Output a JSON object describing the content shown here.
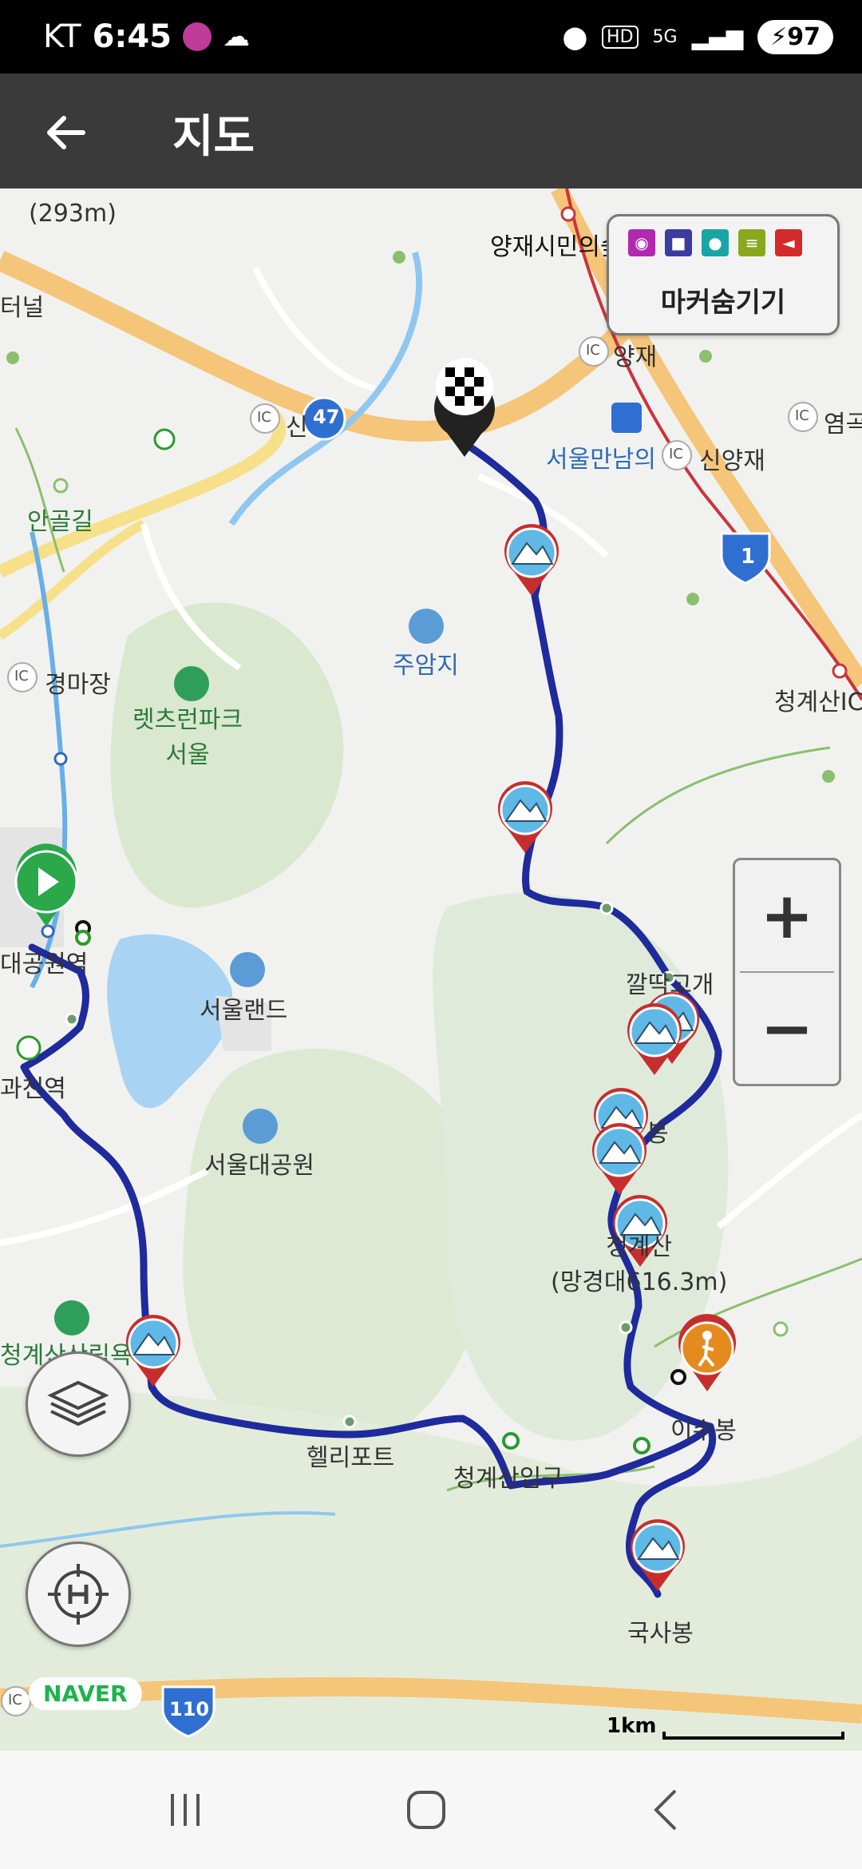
{
  "status_bar": {
    "carrier": "KT",
    "time": "6:45",
    "battery": "97"
  },
  "app_bar": {
    "title": "지도",
    "back_icon": "arrow-left-icon"
  },
  "map": {
    "place_labels": {
      "yangjae_forest": "양재시민의숲",
      "yangjae": "양재",
      "seoul_manam": "서울만남의",
      "sinyangjae": "신양재",
      "yeomgok": "염곡",
      "juamji": "주암지",
      "gyeongmajang": "경마장",
      "letsrun": "렛츠런파크\n서울",
      "seoulland": "서울랜드",
      "seoul_grand_park": "서울대공원",
      "daegongwon_station": "대공원역",
      "gwacheon_station": "과천역",
      "cheonggye_recreation": "청계산산림욕",
      "heliport": "헬리포트",
      "cheonggye_entrance": "청계산입구",
      "isubong": "이수봉",
      "guksabong": "국사봉",
      "kkalttak_pass": "깔딱고개",
      "peak_bong": "봉",
      "cheonggye_peak": "청계산\n(망경대616.3m)",
      "cheonggye_ic": "청계산IC",
      "angolgil": "안골길",
      "tunnel": "터널",
      "peak_293": "(293m)",
      "ic_label": "IC",
      "shin": "신"
    },
    "road_signs": {
      "route47": "47",
      "route1": "1",
      "route110": "110"
    },
    "marker_panel": {
      "label": "마커숨기기",
      "icons": [
        {
          "name": "camera-icon",
          "color": "#b02ab0",
          "glyph": "◉"
        },
        {
          "name": "video-icon",
          "color": "#3b3ba0",
          "glyph": "■"
        },
        {
          "name": "microphone-icon",
          "color": "#1aa5a5",
          "glyph": "●"
        },
        {
          "name": "memo-icon",
          "color": "#8aa81e",
          "glyph": "≡"
        },
        {
          "name": "flag-icon",
          "color": "#d42a2a",
          "glyph": "◄"
        }
      ]
    },
    "zoom": {
      "in_label": "+",
      "out_label": "−"
    },
    "layers_icon": "layers-icon",
    "location_icon": "crosshair-icon",
    "brand": "NAVER",
    "scale_label": "1km"
  },
  "nav_bar": {
    "recents_icon": "recent-apps-icon",
    "home_icon": "home-icon",
    "back_icon": "back-icon"
  }
}
